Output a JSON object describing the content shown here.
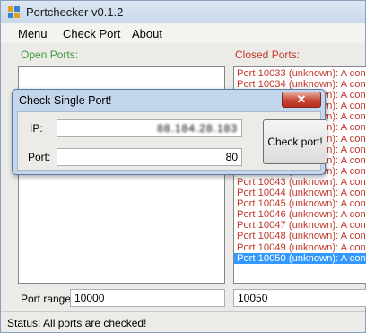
{
  "window": {
    "title": "Portchecker v0.1.2"
  },
  "menu": {
    "items": [
      "Menu",
      "Check Port",
      "About"
    ]
  },
  "open_ports": {
    "label": "Open Ports:"
  },
  "closed_ports": {
    "label": "Closed Ports:",
    "rows": [
      "Port 10033 (unknown): A conn",
      "Port 10034 (unknown): A conn",
      "Port 10035 (unknown): A conn",
      "Port 10036 (unknown): A conn",
      "Port 10037 (unknown): A conn",
      "Port 10038 (unknown): A conn",
      "Port 10039 (unknown): A conn",
      "Port 10040 (unknown): A conn",
      "Port 10041 (unknown): A conn",
      "Port 10042 (unknown): A conn",
      "Port 10043 (unknown): A conn",
      "Port 10044 (unknown): A conn",
      "Port 10045 (unknown): A conn",
      "Port 10046 (unknown): A conn",
      "Port 10047 (unknown): A conn",
      "Port 10048 (unknown): A conn",
      "Port 10049 (unknown): A conn",
      "Port 10050 (unknown): A conn"
    ],
    "selected_index": 17
  },
  "port_range": {
    "label": "Port range:",
    "start": "10000",
    "end": "10050"
  },
  "status": {
    "text": "Status: All ports are checked!"
  },
  "dialog": {
    "title": "Check Single Port!",
    "close_glyph": "✕",
    "ip_label": "IP:",
    "ip_value": "88.184.28.183",
    "port_label": "Port:",
    "port_value": "80",
    "button_label": "Check port!"
  }
}
